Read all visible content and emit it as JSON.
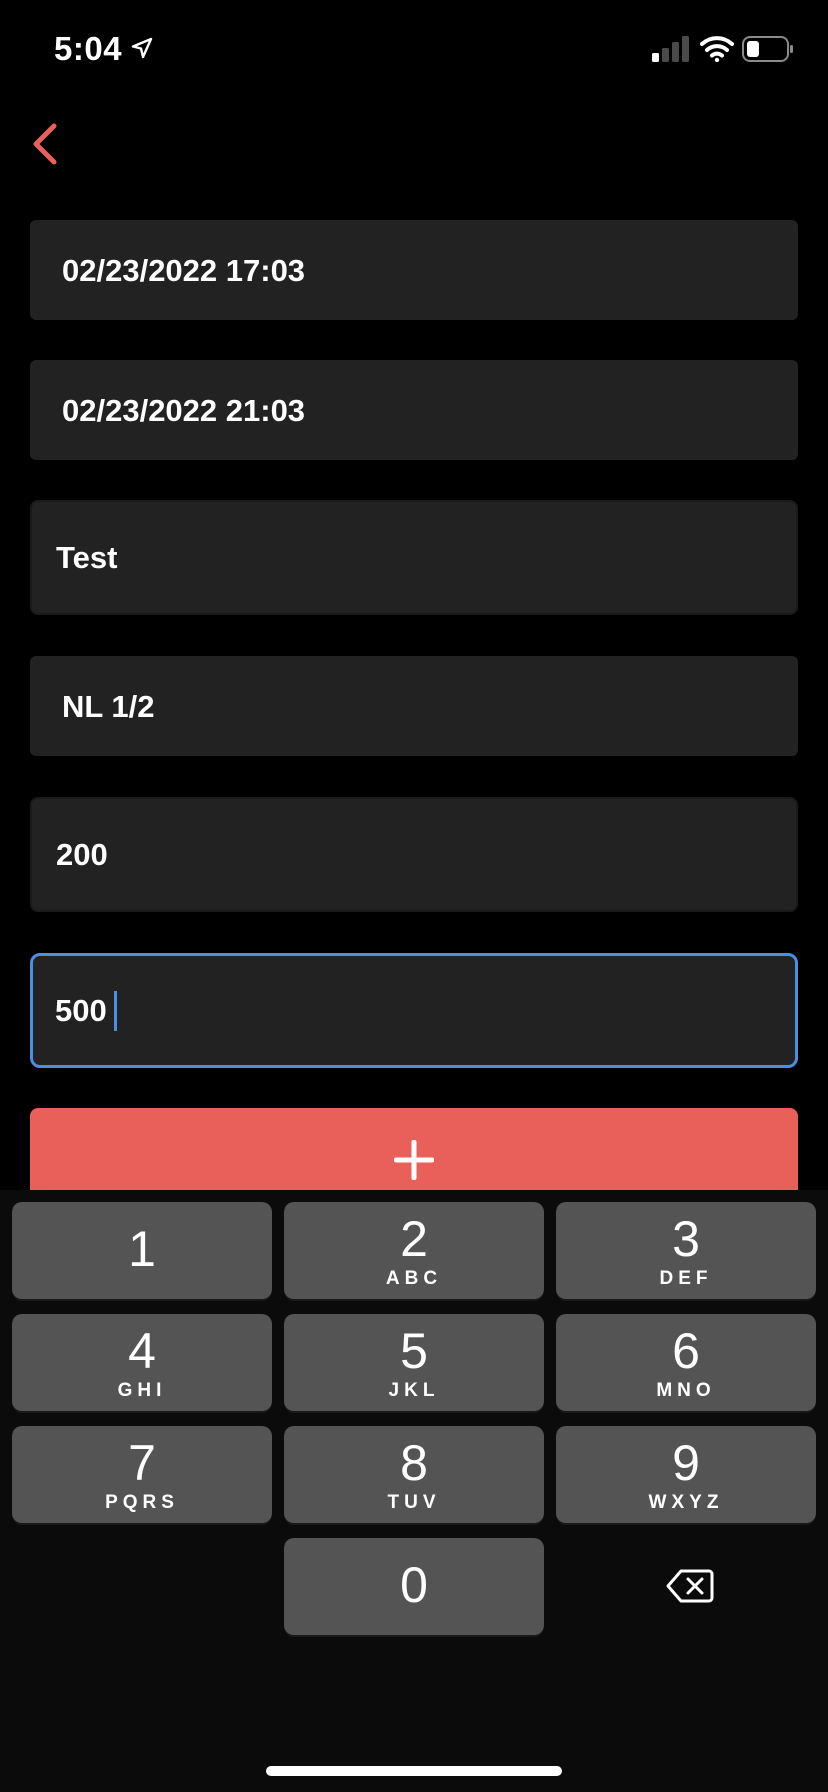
{
  "status_bar": {
    "time": "5:04",
    "icons": [
      "location-arrow-icon",
      "cellular-signal-icon",
      "wifi-icon",
      "battery-icon"
    ]
  },
  "nav": {
    "back_icon": "chevron-left-icon"
  },
  "form": {
    "start_datetime": "02/23/2022 17:03",
    "end_datetime": "02/23/2022 21:03",
    "name": "Test",
    "stakes": "NL 1/2",
    "buy_in": "200",
    "cash_out": "500"
  },
  "add_button": {
    "icon": "plus-icon"
  },
  "keyboard": {
    "keys": [
      {
        "digit": "1",
        "letters": ""
      },
      {
        "digit": "2",
        "letters": "ABC"
      },
      {
        "digit": "3",
        "letters": "DEF"
      },
      {
        "digit": "4",
        "letters": "GHI"
      },
      {
        "digit": "5",
        "letters": "JKL"
      },
      {
        "digit": "6",
        "letters": "MNO"
      },
      {
        "digit": "7",
        "letters": "PQRS"
      },
      {
        "digit": "8",
        "letters": "TUV"
      },
      {
        "digit": "9",
        "letters": "WXYZ"
      },
      {
        "digit": "0",
        "letters": ""
      }
    ],
    "delete_icon": "backspace-icon"
  },
  "colors": {
    "accent_red": "#e95f5a",
    "focus_blue": "#4a8fe0",
    "field_bg": "#222222",
    "key_bg": "#545454"
  }
}
